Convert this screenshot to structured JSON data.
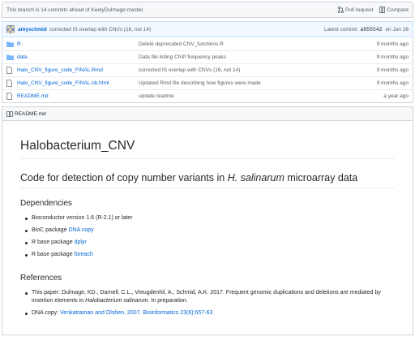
{
  "branch_bar": {
    "message": "This branch is 14 commits ahead of KeelyDulmage:master.",
    "pull_request": "Pull request",
    "compare": "Compare"
  },
  "commit": {
    "author": "amyschmid",
    "message": "corrected IS overlap with CNVs (16, not 14)",
    "latest_prefix": "Latest commit",
    "sha": "a855542",
    "date": "on Jan 26"
  },
  "files": [
    {
      "name": "R",
      "type": "folder",
      "message": "Delete deprecated CNV_functions.R",
      "age": "9 months ago"
    },
    {
      "name": "data",
      "type": "folder",
      "message": "Data file listing ChIP frequency peaks",
      "age": "9 months ago"
    },
    {
      "name": "Halo_CNV_figure_code_FINAL.Rmd",
      "type": "file",
      "message": "corrected IS overlap with CNVs (16, not 14)",
      "age": "9 months ago"
    },
    {
      "name": "Halo_CNV_figure_code_FINAL.nb.html",
      "type": "file",
      "message": "Updated Rmd file describing how figures were made",
      "age": "9 months ago"
    },
    {
      "name": "README.md",
      "type": "file",
      "message": "update readme",
      "age": "a year ago"
    }
  ],
  "readme": {
    "header": "README.md",
    "title": "Halobacterium_CNV",
    "subtitle_pre": "Code for detection of copy number variants in ",
    "subtitle_em": "H. salinarum",
    "subtitle_post": " microarray data",
    "dependencies_heading": "Dependencies",
    "dependencies": {
      "item1": "Bioconductor version 1.6 (R-2.1) or later",
      "item2_pre": "BioC package ",
      "item2_link": "DNA copy",
      "item3_pre": "R base package ",
      "item3_link": "dplyr",
      "item4_pre": "R base package ",
      "item4_link": "foreach"
    },
    "references_heading": "References",
    "references": {
      "ref1_pre": "This paper: Dulmage, KD., Darnell, C.L., Vreugdenhil, A., Schmid, A.K. 2017. Frequent genomic duplications and deletions are mediated by insertion elements in ",
      "ref1_em": "Halobacterium salinarum",
      "ref1_post": ". In preparation.",
      "ref2_pre": "DNA copy: ",
      "ref2_link": "Venkatraman and Olshen, 2007. Bioinformatics 23(6):657-63"
    }
  },
  "colors": {
    "link": "#0366d6",
    "folder": "#79b8ff",
    "text": "#24292e",
    "muted": "#586069"
  }
}
